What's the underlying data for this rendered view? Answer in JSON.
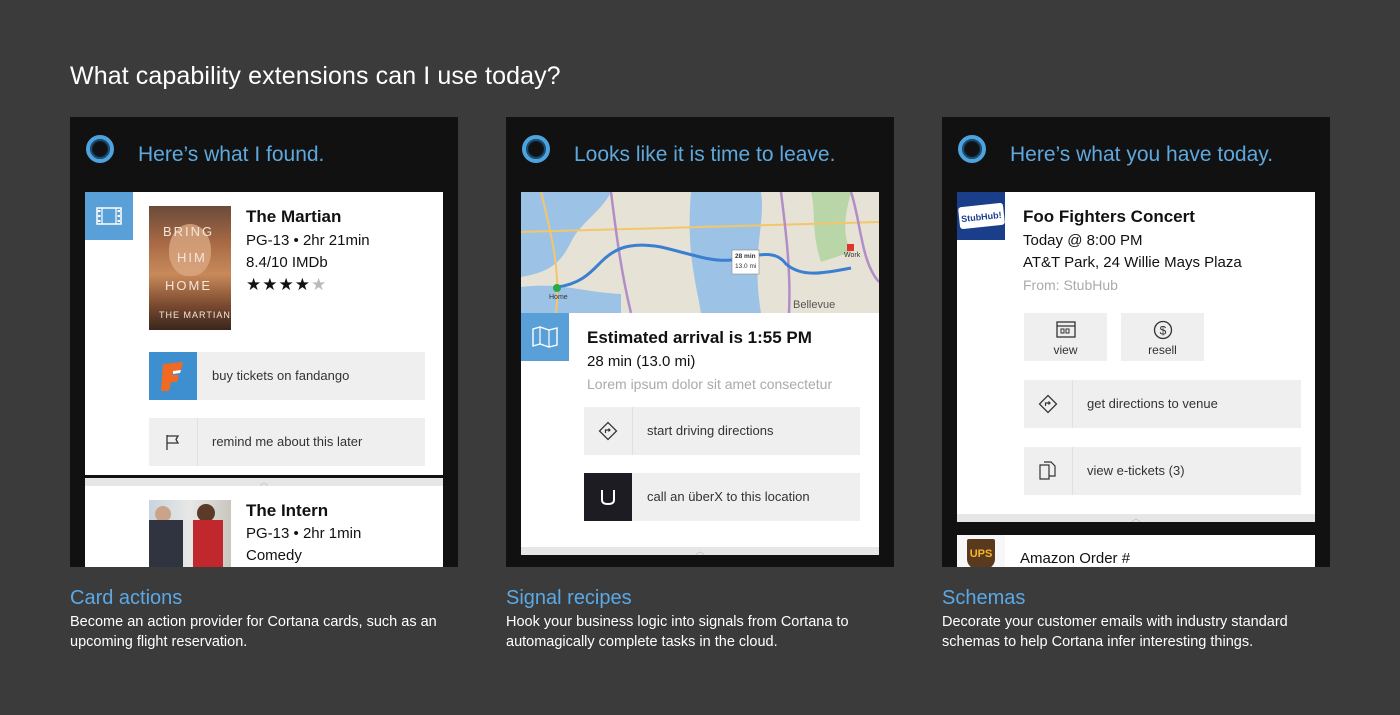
{
  "page": {
    "title": "What capability extensions can I use today?"
  },
  "panels": [
    {
      "heading": "Here’s what I found.",
      "movie1": {
        "title": "The Martian",
        "rating_runtime": "PG-13 • 2hr 21min",
        "score": "8.4/10 IMDb",
        "stars": 4,
        "stars_max": 5,
        "poster_lines": [
          "BRING",
          "HIM",
          "HOME",
          "THE MARTIAN"
        ],
        "actions": [
          {
            "label": "buy tickets on fandango",
            "icon": "fandango-logo-icon"
          },
          {
            "label": "remind me about this later",
            "icon": "flag-icon"
          }
        ]
      },
      "movie2": {
        "title": "The Intern",
        "rating_runtime": "PG-13 • 2hr 1min",
        "genre": "Comedy"
      }
    },
    {
      "heading": "Looks like it is time to leave.",
      "map": {
        "labels": {
          "home": "Home",
          "work": "Work",
          "bellevue": "Bellevue",
          "eta_min": "28 min",
          "eta_mi": "13.0 mi"
        }
      },
      "arrival": {
        "title": "Estimated arrival is 1:55 PM",
        "detail": "28 min (13.0 mi)",
        "note": "Lorem ipsum dolor sit amet consectetur"
      },
      "actions": [
        {
          "label": "start driving directions",
          "icon": "directions-icon"
        },
        {
          "label": "call an überX to this location",
          "icon": "uber-logo-icon"
        }
      ]
    },
    {
      "heading": "Here’s what you have today.",
      "event": {
        "logo_text": "StubHub!",
        "title": "Foo Fighters Concert",
        "time": "Today @ 8:00 PM",
        "venue": "AT&T Park, 24 Willie Mays Plaza",
        "source": "From: StubHub"
      },
      "buttons": [
        {
          "label": "view",
          "icon": "calendar-icon"
        },
        {
          "label": "resell",
          "icon": "dollar-icon"
        }
      ],
      "actions": [
        {
          "label": "get directions to venue",
          "icon": "directions-icon"
        },
        {
          "label": "view e-tickets (3)",
          "icon": "tickets-icon"
        }
      ],
      "next_card": {
        "logo_text": "UPS",
        "title": "Amazon Order #"
      }
    }
  ],
  "captions": [
    {
      "title": "Card actions",
      "body": "Become an action provider for Cortana cards, such as an upcoming flight reservation."
    },
    {
      "title": "Signal recipes",
      "body": "Hook your business logic into signals from Cortana to automagically complete tasks in the cloud."
    },
    {
      "title": "Schemas",
      "body": "Decorate your customer emails with industry standard schemas to help Cortana infer interesting things."
    }
  ],
  "colors": {
    "background": "#3b3b3b",
    "panel": "#111111",
    "accent": "#5aa0d8",
    "fandango": "#f15a22",
    "stubhub": "#1b3e8a",
    "ups": "#5a3a1e"
  }
}
